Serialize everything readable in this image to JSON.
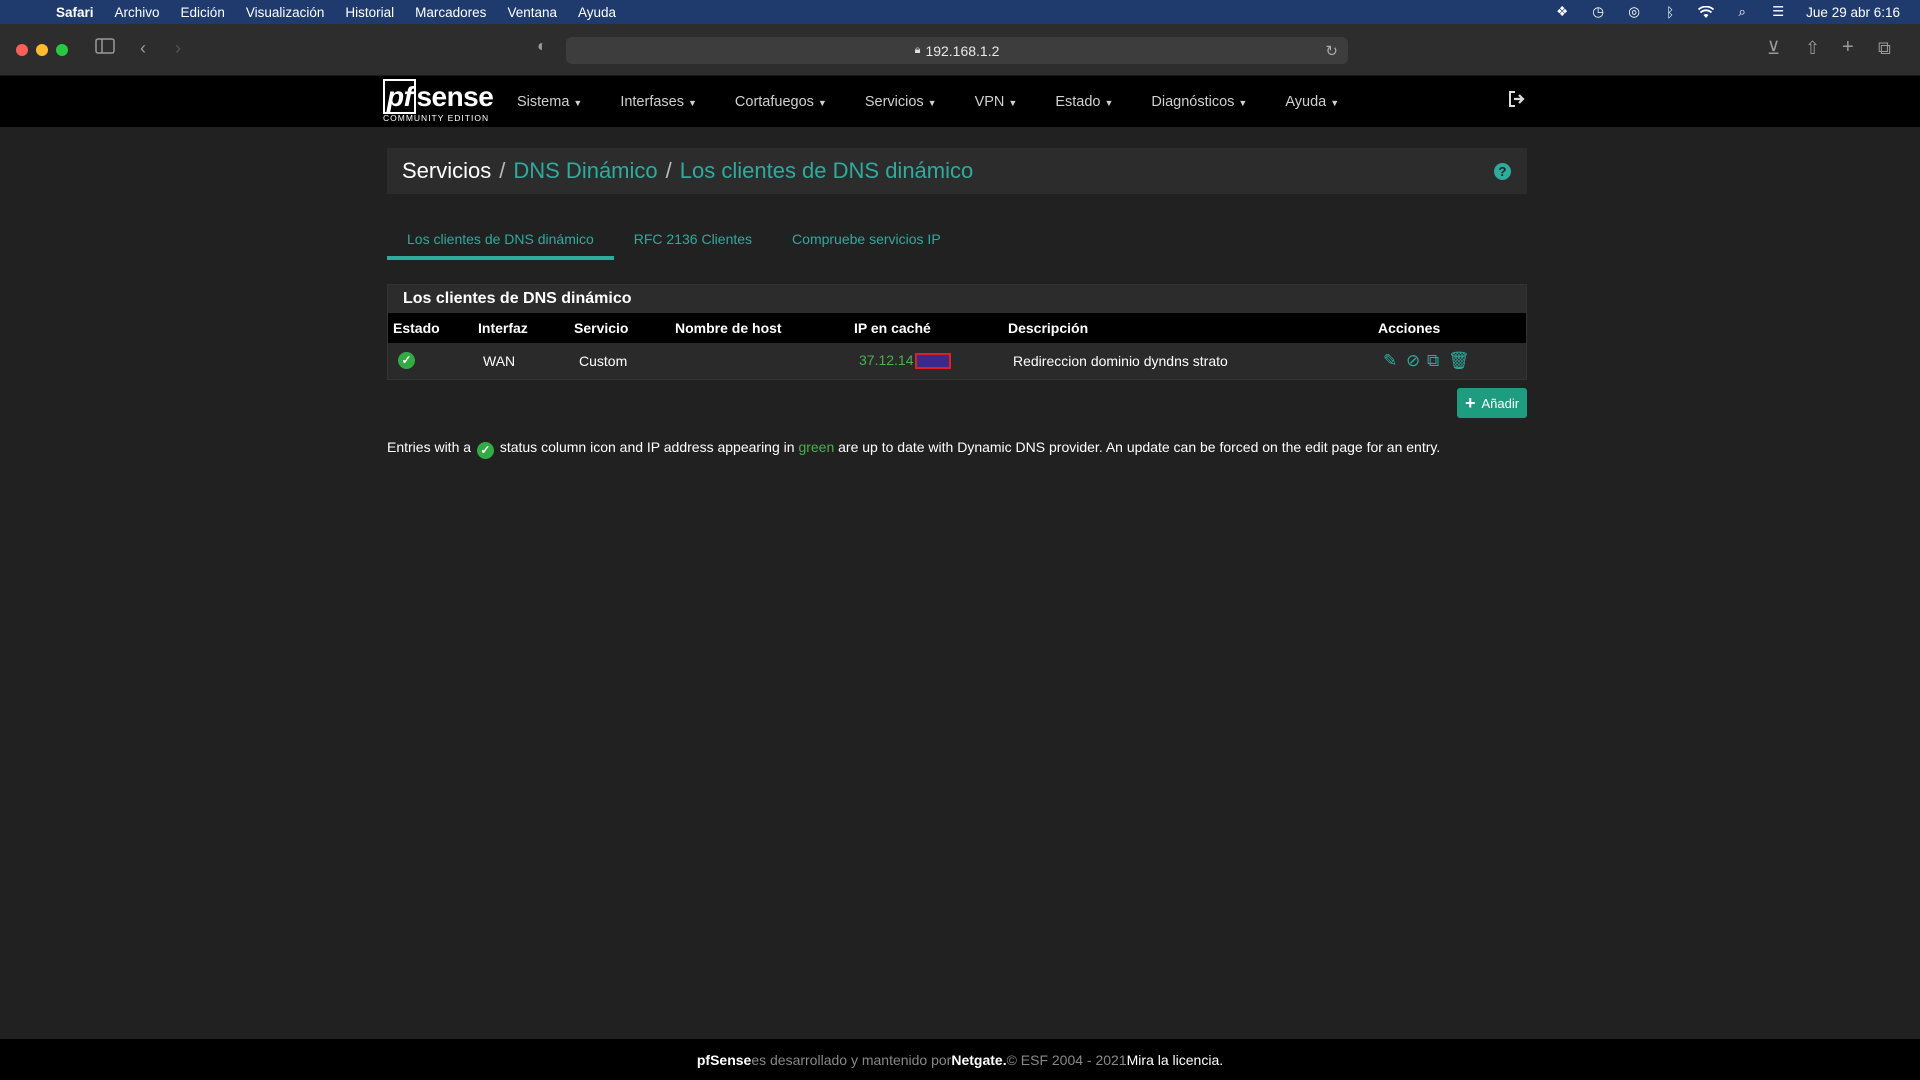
{
  "menubar": {
    "items": [
      "Safari",
      "Archivo",
      "Edición",
      "Visualización",
      "Historial",
      "Marcadores",
      "Ventana",
      "Ayuda"
    ],
    "clock": "Jue 29 abr  6:16"
  },
  "browser": {
    "url": "192.168.1.2"
  },
  "logo": {
    "pf": "pf",
    "sense": "sense",
    "edition": "COMMUNITY EDITION"
  },
  "nav": {
    "items": [
      "Sistema",
      "Interfases",
      "Cortafuegos",
      "Servicios",
      "VPN",
      "Estado",
      "Diagnósticos",
      "Ayuda"
    ]
  },
  "breadcrumb": {
    "first": "Servicios",
    "second": "DNS Dinámico",
    "third": "Los clientes de DNS dinámico"
  },
  "tabs": [
    "Los clientes de DNS dinámico",
    "RFC 2136 Clientes",
    "Compruebe servicios IP"
  ],
  "panel": {
    "title": "Los clientes de DNS dinámico",
    "columns": [
      "Estado",
      "Interfaz",
      "Servicio",
      "Nombre de host",
      "IP en caché",
      "Descripción",
      "Acciones"
    ],
    "rows": [
      {
        "interface": "WAN",
        "service": "Custom",
        "hostname": "",
        "ip": "37.12.14",
        "description": "Redireccion dominio dyndns strato"
      }
    ]
  },
  "add_button": "Añadir",
  "note": {
    "part1": "Entries with a",
    "part2": "status column icon and IP address appearing in",
    "green": "green",
    "part3": "are up to date with Dynamic DNS provider. An update can be forced on the edit page for an entry."
  },
  "footer": {
    "brand": "pfSense",
    "text1": "es desarrollado y mantenido por",
    "company": "Netgate.",
    "copyright": " © ESF 2004 - 2021",
    "license": "Mira la licencia."
  },
  "colors": {
    "accent": "#2eab9d",
    "ok_green": "#33aa44"
  }
}
